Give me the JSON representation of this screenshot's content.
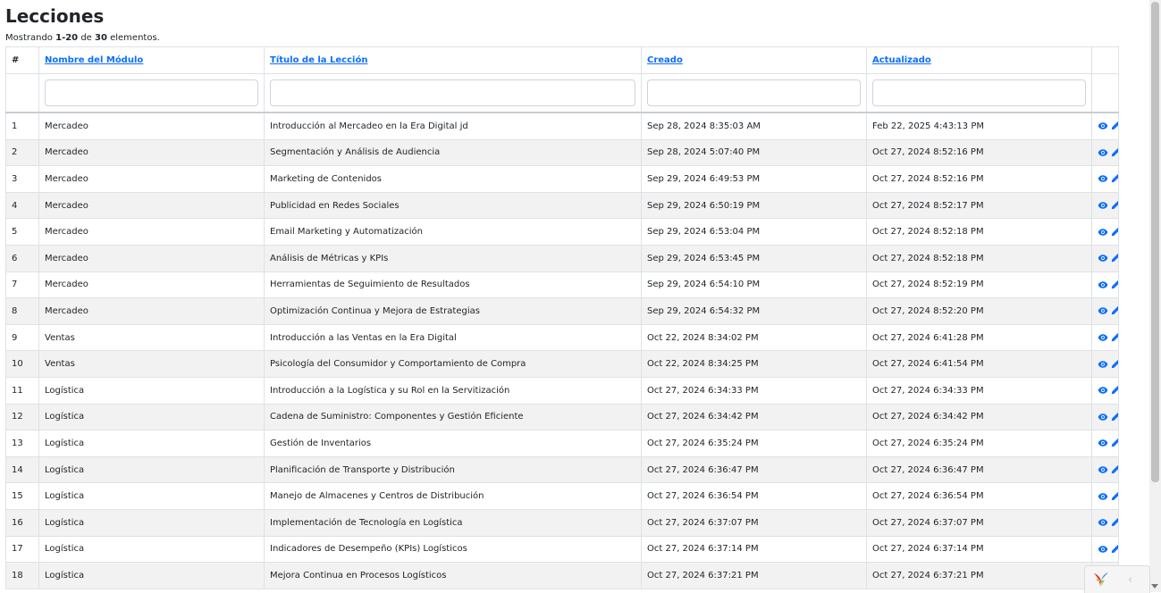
{
  "page": {
    "title": "Lecciones"
  },
  "summary": {
    "prefix": "Mostrando ",
    "range": "1-20",
    "middle": " de ",
    "total": "30",
    "suffix": " elementos."
  },
  "table": {
    "headers": {
      "index": "#",
      "module": "Nombre del Módulo",
      "title": "Título de la Lección",
      "created": "Creado",
      "updated": "Actualizado"
    },
    "rows": [
      {
        "n": "1",
        "module": "Mercadeo",
        "title": "Introducción al Mercadeo en la Era Digital jd",
        "created": "Sep 28, 2024 8:35:03 AM",
        "updated": "Feb 22, 2025 4:43:13 PM"
      },
      {
        "n": "2",
        "module": "Mercadeo",
        "title": "Segmentación y Análisis de Audiencia",
        "created": "Sep 28, 2024 5:07:40 PM",
        "updated": "Oct 27, 2024 8:52:16 PM"
      },
      {
        "n": "3",
        "module": "Mercadeo",
        "title": "Marketing de Contenidos",
        "created": "Sep 29, 2024 6:49:53 PM",
        "updated": "Oct 27, 2024 8:52:16 PM"
      },
      {
        "n": "4",
        "module": "Mercadeo",
        "title": "Publicidad en Redes Sociales",
        "created": "Sep 29, 2024 6:50:19 PM",
        "updated": "Oct 27, 2024 8:52:17 PM"
      },
      {
        "n": "5",
        "module": "Mercadeo",
        "title": "Email Marketing y Automatización",
        "created": "Sep 29, 2024 6:53:04 PM",
        "updated": "Oct 27, 2024 8:52:18 PM"
      },
      {
        "n": "6",
        "module": "Mercadeo",
        "title": "Análisis de Métricas y KPIs",
        "created": "Sep 29, 2024 6:53:45 PM",
        "updated": "Oct 27, 2024 8:52:18 PM"
      },
      {
        "n": "7",
        "module": "Mercadeo",
        "title": "Herramientas de Seguimiento de Resultados",
        "created": "Sep 29, 2024 6:54:10 PM",
        "updated": "Oct 27, 2024 8:52:19 PM"
      },
      {
        "n": "8",
        "module": "Mercadeo",
        "title": "Optimización Continua y Mejora de Estrategias",
        "created": "Sep 29, 2024 6:54:32 PM",
        "updated": "Oct 27, 2024 8:52:20 PM"
      },
      {
        "n": "9",
        "module": "Ventas",
        "title": "Introducción a las Ventas en la Era Digital",
        "created": "Oct 22, 2024 8:34:02 PM",
        "updated": "Oct 27, 2024 6:41:28 PM"
      },
      {
        "n": "10",
        "module": "Ventas",
        "title": "Psicología del Consumidor y Comportamiento de Compra",
        "created": "Oct 22, 2024 8:34:25 PM",
        "updated": "Oct 27, 2024 6:41:54 PM"
      },
      {
        "n": "11",
        "module": "Logística",
        "title": "Introducción a la Logística y su Rol en la Servitización",
        "created": "Oct 27, 2024 6:34:33 PM",
        "updated": "Oct 27, 2024 6:34:33 PM"
      },
      {
        "n": "12",
        "module": "Logística",
        "title": "Cadena de Suministro: Componentes y Gestión Eficiente",
        "created": "Oct 27, 2024 6:34:42 PM",
        "updated": "Oct 27, 2024 6:34:42 PM"
      },
      {
        "n": "13",
        "module": "Logística",
        "title": "Gestión de Inventarios",
        "created": "Oct 27, 2024 6:35:24 PM",
        "updated": "Oct 27, 2024 6:35:24 PM"
      },
      {
        "n": "14",
        "module": "Logística",
        "title": "Planificación de Transporte y Distribución",
        "created": "Oct 27, 2024 6:36:47 PM",
        "updated": "Oct 27, 2024 6:36:47 PM"
      },
      {
        "n": "15",
        "module": "Logística",
        "title": "Manejo de Almacenes y Centros de Distribución",
        "created": "Oct 27, 2024 6:36:54 PM",
        "updated": "Oct 27, 2024 6:36:54 PM"
      },
      {
        "n": "16",
        "module": "Logística",
        "title": "Implementación de Tecnología en Logística",
        "created": "Oct 27, 2024 6:37:07 PM",
        "updated": "Oct 27, 2024 6:37:07 PM"
      },
      {
        "n": "17",
        "module": "Logística",
        "title": "Indicadores de Desempeño (KPIs) Logísticos",
        "created": "Oct 27, 2024 6:37:14 PM",
        "updated": "Oct 27, 2024 6:37:14 PM"
      },
      {
        "n": "18",
        "module": "Logística",
        "title": "Mejora Continua en Procesos Logísticos",
        "created": "Oct 27, 2024 6:37:21 PM",
        "updated": "Oct 27, 2024 6:37:21 PM"
      }
    ]
  },
  "actions": {
    "view_icon": "eye-icon",
    "edit_icon": "pencil-icon"
  },
  "debug_toolbar": {
    "logo": "yii-logo",
    "toggle": "‹"
  },
  "colors": {
    "link": "#0d6efd",
    "stripe": "#f2f2f2",
    "border": "#dee2e6"
  }
}
